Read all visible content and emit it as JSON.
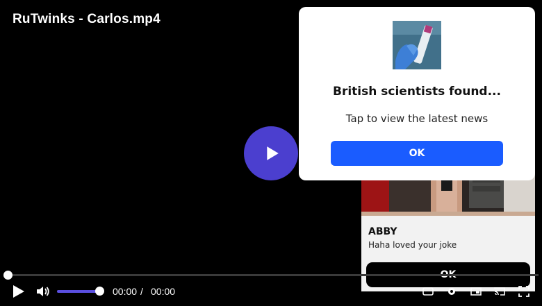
{
  "video": {
    "title": "RuTwinks - Carlos.mp4",
    "current_time": "00:00",
    "separator": "/",
    "duration": "00:00",
    "progress_fraction": 0,
    "volume_fraction": 1
  },
  "news_popup": {
    "headline": "British scientists found...",
    "subtitle": "Tap to view the latest news",
    "ok_label": "OK",
    "button_color": "#1a5cff",
    "thumbnail_icon": "test-tube-photo"
  },
  "chat_card": {
    "name": "ABBY",
    "message": "Haha loved your joke",
    "ok_label": "OK"
  },
  "colors": {
    "accent": "#4b3fcf",
    "volume_fill": "#5a4fe0"
  },
  "icons": {
    "big_play": "play-icon",
    "play": "play-icon",
    "volume": "volume-icon",
    "captions": "captions-icon",
    "settings": "gear-icon",
    "pip": "pip-icon",
    "cast": "cast-icon",
    "fullscreen": "fullscreen-icon"
  }
}
